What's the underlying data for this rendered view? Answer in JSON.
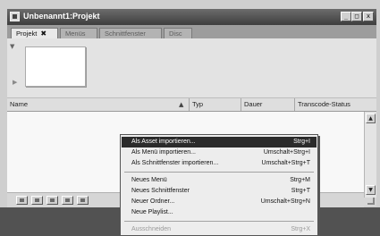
{
  "window": {
    "title": "Unbenannt1:Projekt",
    "buttons": {
      "minimize": "_",
      "maximize": "□",
      "close": "x"
    }
  },
  "tabs": [
    {
      "label": "Projekt",
      "close": "✖"
    },
    {
      "label": "Menüs"
    },
    {
      "label": "Schnittfenster"
    },
    {
      "label": "Disc"
    }
  ],
  "columns": {
    "name": "Name",
    "typ": "Typ",
    "dauer": "Dauer",
    "transcode": "Transcode-Status"
  },
  "context_menu": {
    "items": [
      {
        "label": "Als Asset importieren...",
        "shortcut": "Strg+I"
      },
      {
        "label": "Als Menü importieren...",
        "shortcut": "Umschalt+Strg+I"
      },
      {
        "label": "Als Schnittfenster importieren...",
        "shortcut": "Umschalt+Strg+T"
      },
      {
        "label": "Neues Menü",
        "shortcut": "Strg+M"
      },
      {
        "label": "Neues Schnittfenster",
        "shortcut": "Strg+T"
      },
      {
        "label": "Neuer Ordner...",
        "shortcut": "Umschalt+Strg+N"
      },
      {
        "label": "Neue Playlist...",
        "shortcut": ""
      },
      {
        "label": "Ausschneiden",
        "shortcut": "Strg+X"
      }
    ]
  }
}
